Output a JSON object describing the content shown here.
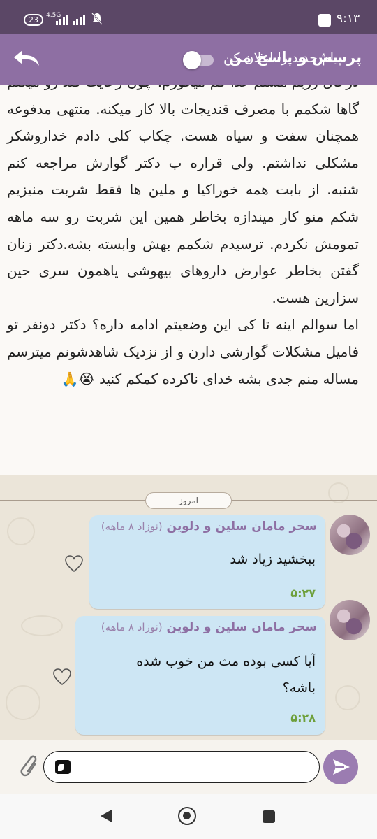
{
  "status_bar": {
    "time": "۹:۱۳",
    "battery": "23",
    "network": "4.5G"
  },
  "header": {
    "title": "پرسش و پاسخ من",
    "notify_label": "پیام جدید را اعلان کن",
    "notify_enabled": false
  },
  "post": {
    "paragraphs": [
      "درحال رژیم هستم غذا کم میخورم. چون رعایت قند رو میکنم گاها شکمم با مصرف قندیجات بالا کار میکنه. منتهی مدفوعه همچنان سفت و سیاه هست. چکاب کلی دادم خداروشکر مشکلی نداشتم. ولی قراره ب دکتر گوارش مراجعه کنم شنبه. از بابت همه خوراکیا و ملین ها فقط شربت منیزیم شکم منو کار میندازه بخاطر همین این شربت رو سه ماهه تمومش نکردم. ترسیدم شکمم بهش وابسته بشه.دکتر زنان گفتن بخاطر عوارض داروهای بیهوشی یاهمون سری حین سزارین هست.",
      "اما سوالم اینه تا کی این وضعیتم ادامه داره؟ دکتر دونفر تو فامیل مشکلات گوارشی دارن و از نزدیک شاهدشونم میترسم مساله منم جدی بشه خدای ناکرده کمکم کنید 😭🙏"
    ]
  },
  "chat": {
    "date_divider": "امروز",
    "messages": [
      {
        "sender": "سحر مامان سلین و دلوین",
        "sender_sub": "(نوزاد ۸ ماهه)",
        "text": "ببخشید زیاد شد",
        "time": "۵:۲۷"
      },
      {
        "sender": "سحر مامان سلین و دلوین",
        "sender_sub": "(نوزاد ۸ ماهه)",
        "text": "آیا کسی بوده مث من خوب شده باشه؟",
        "time": "۵:۲۸"
      }
    ]
  },
  "composer": {
    "input_value": "",
    "placeholder": ""
  },
  "colors": {
    "status_bar": "#5b4766",
    "header": "#8e6fa3",
    "bubble": "#cde6f4",
    "time_text": "#6ea03c",
    "send_button": "#9b7cb1"
  },
  "icons": [
    "back-arrow-icon",
    "attach-icon",
    "emoji-icon",
    "send-icon",
    "heart-icon",
    "nav-back-icon",
    "nav-home-icon",
    "nav-recents-icon"
  ]
}
